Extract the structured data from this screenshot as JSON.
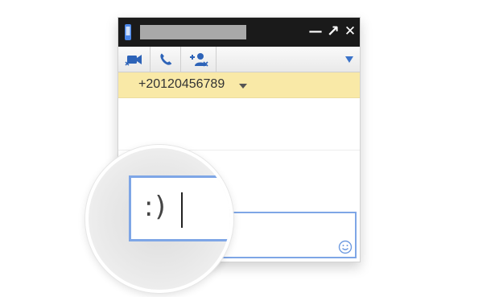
{
  "title_bar": {
    "minimize_label": "—",
    "popout_label": "↗",
    "close_label": "✕"
  },
  "toolbar": {
    "buttons": [
      "video-call",
      "voice-call",
      "add-participant"
    ],
    "menu_icon": "triangle-down"
  },
  "contact": {
    "phone_number": "+20120456789"
  },
  "compose": {
    "magnified_text": ":)",
    "emoticon_icon": "smiley-face"
  },
  "colors": {
    "title_bar": "#1a1a1a",
    "accent_blue": "#3b73c9",
    "phone_bar": "#f9e9a7",
    "input_border": "#7ea6e6"
  }
}
